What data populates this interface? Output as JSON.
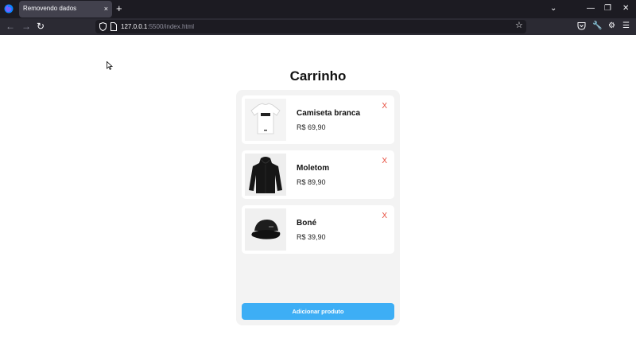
{
  "browser": {
    "tab_title": "Removendo dados",
    "tab_close": "×",
    "new_tab": "+",
    "url_host": "127.0.0.1",
    "url_path": ":5500/index.html",
    "icons": [
      "firefox-icon",
      "back-icon",
      "forward-icon",
      "reload-icon",
      "shield-icon",
      "page-icon",
      "bookmark-star-icon",
      "pocket-icon",
      "wrench-icon",
      "extensions-icon",
      "menu-icon",
      "list-tabs-icon",
      "minimize-icon",
      "restore-icon",
      "close-icon"
    ]
  },
  "page": {
    "title": "Carrinho",
    "items": [
      {
        "name": "Camiseta branca",
        "price": "R$ 69,90",
        "remove": "X",
        "image": "white-tshirt"
      },
      {
        "name": "Moletom",
        "price": "R$ 89,90",
        "remove": "X",
        "image": "black-hoodie"
      },
      {
        "name": "Boné",
        "price": "R$ 39,90",
        "remove": "X",
        "image": "black-cap"
      }
    ],
    "add_button": "Adicionar produto"
  },
  "colors": {
    "accent": "#3daef5",
    "remove": "#e74c3c",
    "tabbar": "#1c1b22",
    "navbar": "#2b2a33",
    "cart_bg": "#f3f3f3"
  }
}
